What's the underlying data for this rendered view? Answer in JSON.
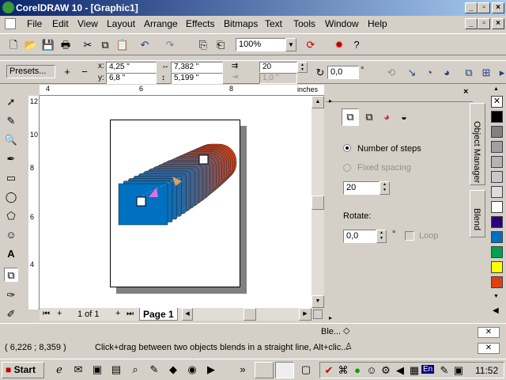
{
  "window": {
    "title": "CorelDRAW 10 - [Graphic1]"
  },
  "menus": [
    "File",
    "Edit",
    "View",
    "Layout",
    "Arrange",
    "Effects",
    "Bitmaps",
    "Text",
    "Tools",
    "Window",
    "Help"
  ],
  "standard_toolbar": {
    "zoom": "100%"
  },
  "property_bar": {
    "presets": "Presets...",
    "x": "4,25 \"",
    "y": "6,8 \"",
    "width": "7,382 \"",
    "height": "5,199 \"",
    "steps": "20",
    "spacing": "1,0 \"",
    "rotation": "0,0",
    "rotation_unit": "°"
  },
  "ruler": {
    "units": "inches",
    "top_ticks": [
      "4",
      "6",
      "8"
    ],
    "left_ticks": [
      "12",
      "10",
      "8",
      "6",
      "4"
    ]
  },
  "page_nav": {
    "counter": "1 of 1",
    "tab": "Page 1"
  },
  "blend_colors": {
    "start": "#0070c0",
    "end": "#e04010"
  },
  "docker": {
    "number_of_steps": "Number of steps",
    "fixed_spacing": "Fixed spacing",
    "steps_value": "20",
    "rotate_label": "Rotate:",
    "rotate_value": "0,0",
    "rotate_unit": "°",
    "loop_label": "Loop",
    "tabs": [
      "Object Manager",
      "Blend"
    ]
  },
  "palette": [
    "#ffffff",
    "#000000",
    "#808080",
    "#a0a0a0",
    "#b4b4b4",
    "#c8c8c8",
    "#dcdcdc",
    "#ffffff",
    "#2a0080",
    "#0070c0",
    "#00a050",
    "#ffff00",
    "#e04010"
  ],
  "status": {
    "coords": "( 6,226 ; 8,359 )",
    "hint": "Click+drag between two objects blends in a straight line, Alt+clic...",
    "object_label": "Ble..."
  },
  "taskbar": {
    "start": "Start",
    "lang": "En",
    "time": "11:52"
  }
}
